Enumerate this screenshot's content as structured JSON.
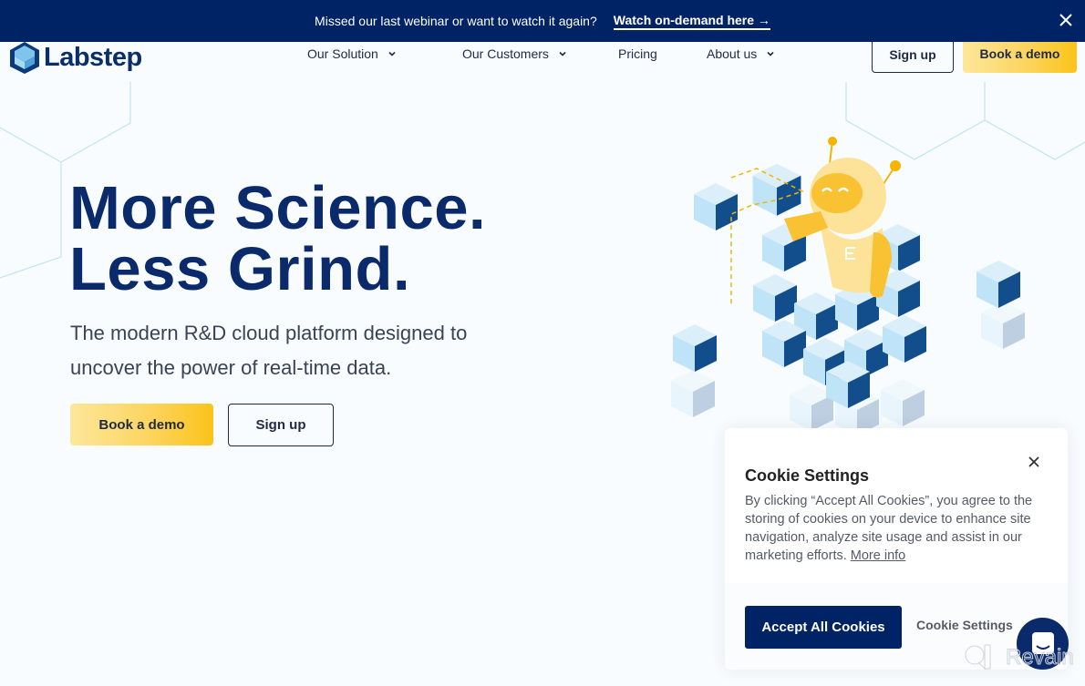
{
  "banner": {
    "message": "Missed our last webinar or want to watch it again?",
    "link_label": "Watch on-demand here →",
    "close_icon": "close-icon"
  },
  "header": {
    "logo_text": "Labstep",
    "nav": [
      {
        "label": "Our Solution",
        "has_dropdown": true
      },
      {
        "label": "Our Customers",
        "has_dropdown": true
      },
      {
        "label": "Pricing",
        "has_dropdown": false
      },
      {
        "label": "About us",
        "has_dropdown": true
      }
    ],
    "signup_label": "Sign up",
    "demo_label": "Book a demo"
  },
  "hero": {
    "title_line1": "More Science.",
    "title_line2": "Less Grind.",
    "subtitle": "The modern R&D cloud platform designed to uncover the power of real-time data.",
    "demo_label": "Book a demo",
    "signup_label": "Sign up",
    "illustration": "robot-on-cube-illustration"
  },
  "cookie": {
    "title": "Cookie Settings",
    "body": "By clicking “Accept All Cookies”, you agree to the storing of cookies on your device to enhance site navigation, analyze site usage and assist in our marketing efforts.",
    "more_info": "More info",
    "accept_label": "Accept All Cookies",
    "settings_label": "Cookie Settings"
  },
  "chat": {
    "icon": "chat-icon"
  },
  "watermark": {
    "text": "Revain"
  },
  "colors": {
    "navy": "#002366",
    "heading": "#0a2a6b",
    "yellow_start": "#fde79a",
    "yellow_end": "#fbc31a",
    "background": "#f8fcfe",
    "hex_lines": "#bfe6ee"
  }
}
